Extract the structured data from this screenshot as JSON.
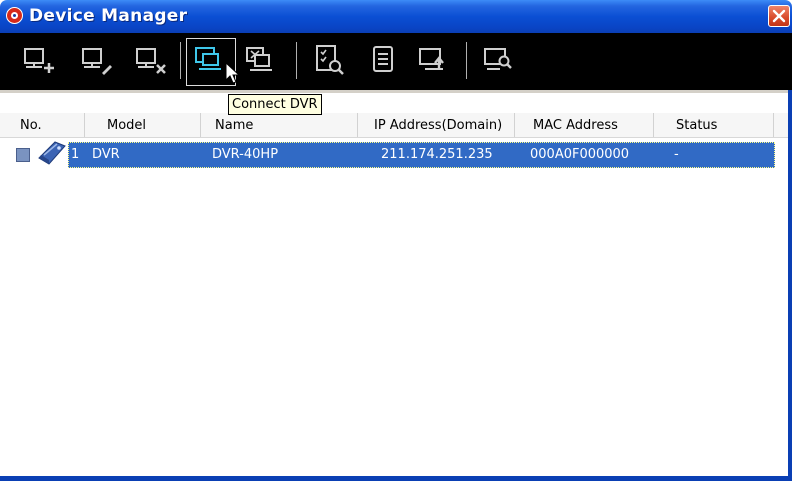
{
  "window": {
    "title": "Device Manager",
    "accent_color": "#0b4fd4",
    "icons": {
      "app": "app-logo-icon",
      "close": "close-icon"
    }
  },
  "toolbar": {
    "buttons": [
      {
        "icon": "add-device-icon",
        "state": "normal"
      },
      {
        "icon": "edit-device-icon",
        "state": "normal"
      },
      {
        "icon": "delete-device-icon",
        "state": "normal"
      },
      {
        "icon": "connect-dvr-icon",
        "state": "hover"
      },
      {
        "icon": "disconnect-dvr-icon",
        "state": "normal"
      },
      {
        "icon": "device-list-search-icon",
        "state": "normal"
      },
      {
        "icon": "document-icon",
        "state": "normal"
      },
      {
        "icon": "upload-device-icon",
        "state": "normal"
      },
      {
        "icon": "find-device-icon",
        "state": "normal"
      }
    ],
    "tooltip": "Connect DVR"
  },
  "table": {
    "columns": [
      "No.",
      "Model",
      "Name",
      "IP Address(Domain)",
      "MAC Address",
      "Status"
    ],
    "rows": [
      {
        "no": "1",
        "model": "DVR",
        "name": "DVR-40HP",
        "ip": "211.174.251.235",
        "mac": "000A0F000000",
        "status": "-",
        "selected": true
      }
    ],
    "selection_color": "#316ac5"
  }
}
